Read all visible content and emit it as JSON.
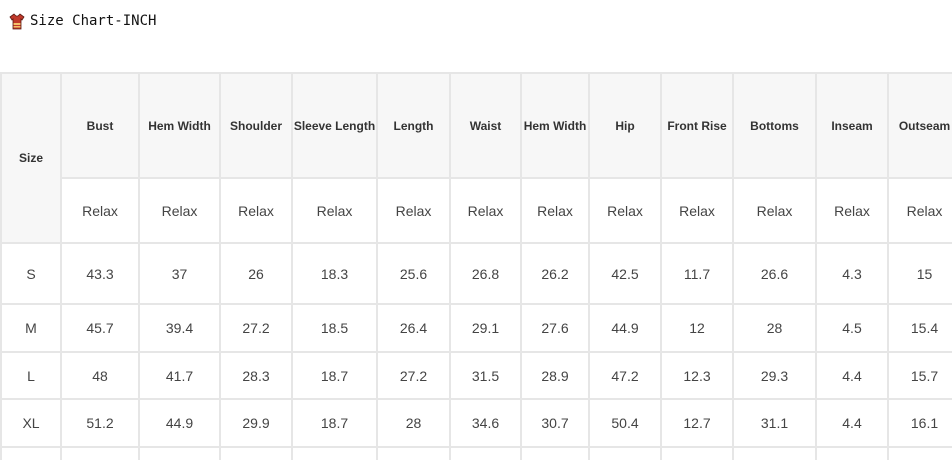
{
  "header": {
    "icon": "shirt-icon",
    "title": "Size Chart-INCH"
  },
  "table": {
    "size_label": "Size",
    "columns": [
      "Bust",
      "Hem Width",
      "Shoulder",
      "Sleeve Length",
      "Length",
      "Waist",
      "Hem Width",
      "Hip",
      "Front Rise",
      "Bottoms",
      "Inseam",
      "Outseam"
    ],
    "fit": [
      "Relax",
      "Relax",
      "Relax",
      "Relax",
      "Relax",
      "Relax",
      "Relax",
      "Relax",
      "Relax",
      "Relax",
      "Relax",
      "Relax"
    ],
    "rows": [
      {
        "size": "S",
        "values": [
          "43.3",
          "37",
          "26",
          "18.3",
          "25.6",
          "26.8",
          "26.2",
          "42.5",
          "11.7",
          "26.6",
          "4.3",
          "15"
        ]
      },
      {
        "size": "M",
        "values": [
          "45.7",
          "39.4",
          "27.2",
          "18.5",
          "26.4",
          "29.1",
          "27.6",
          "44.9",
          "12",
          "28",
          "4.5",
          "15.4"
        ]
      },
      {
        "size": "L",
        "values": [
          "48",
          "41.7",
          "28.3",
          "18.7",
          "27.2",
          "31.5",
          "28.9",
          "47.2",
          "12.3",
          "29.3",
          "4.4",
          "15.7"
        ]
      },
      {
        "size": "XL",
        "values": [
          "51.2",
          "44.9",
          "29.9",
          "18.7",
          "28",
          "34.6",
          "30.7",
          "50.4",
          "12.7",
          "31.1",
          "4.4",
          "16.1"
        ]
      }
    ]
  },
  "colors": {
    "border": "#e6e6e6",
    "header_bg": "#f7f7f7",
    "text": "#444444",
    "icon_red": "#c0392b"
  }
}
